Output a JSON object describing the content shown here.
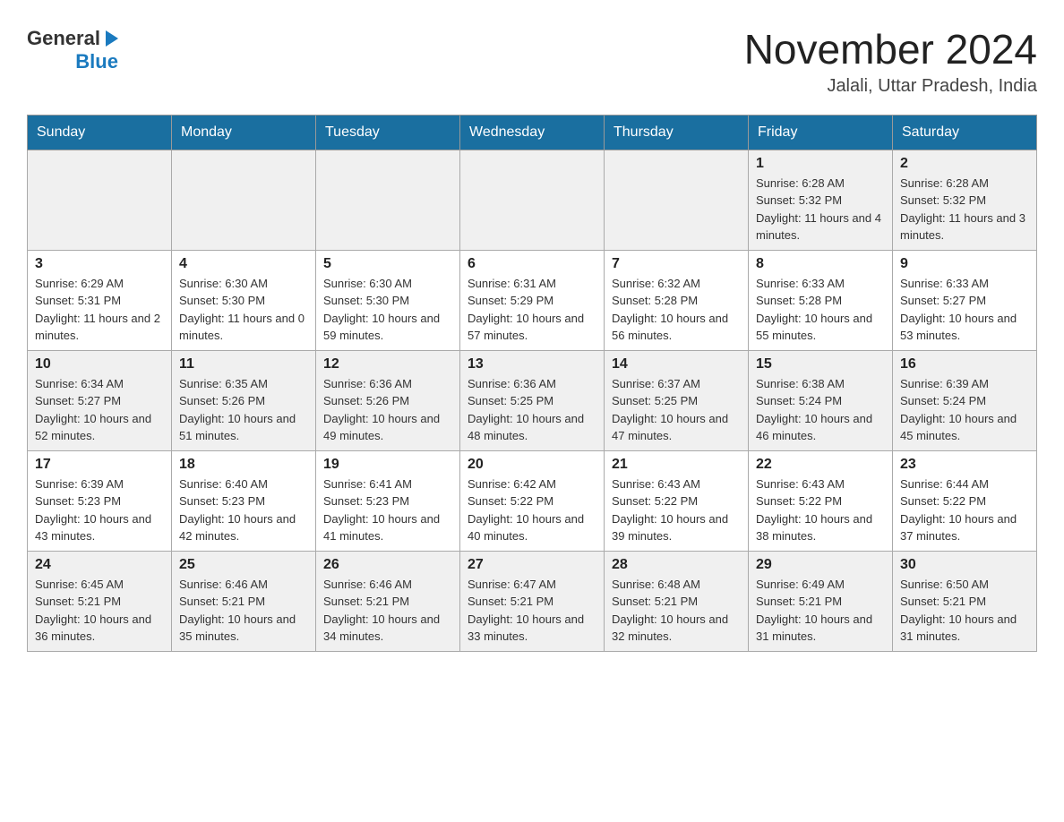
{
  "header": {
    "logo": {
      "general": "General",
      "blue": "Blue",
      "arrow": "▶"
    },
    "title": "November 2024",
    "location": "Jalali, Uttar Pradesh, India"
  },
  "calendar": {
    "days_of_week": [
      "Sunday",
      "Monday",
      "Tuesday",
      "Wednesday",
      "Thursday",
      "Friday",
      "Saturday"
    ],
    "weeks": [
      [
        {
          "day": "",
          "info": ""
        },
        {
          "day": "",
          "info": ""
        },
        {
          "day": "",
          "info": ""
        },
        {
          "day": "",
          "info": ""
        },
        {
          "day": "",
          "info": ""
        },
        {
          "day": "1",
          "info": "Sunrise: 6:28 AM\nSunset: 5:32 PM\nDaylight: 11 hours and 4 minutes."
        },
        {
          "day": "2",
          "info": "Sunrise: 6:28 AM\nSunset: 5:32 PM\nDaylight: 11 hours and 3 minutes."
        }
      ],
      [
        {
          "day": "3",
          "info": "Sunrise: 6:29 AM\nSunset: 5:31 PM\nDaylight: 11 hours and 2 minutes."
        },
        {
          "day": "4",
          "info": "Sunrise: 6:30 AM\nSunset: 5:30 PM\nDaylight: 11 hours and 0 minutes."
        },
        {
          "day": "5",
          "info": "Sunrise: 6:30 AM\nSunset: 5:30 PM\nDaylight: 10 hours and 59 minutes."
        },
        {
          "day": "6",
          "info": "Sunrise: 6:31 AM\nSunset: 5:29 PM\nDaylight: 10 hours and 57 minutes."
        },
        {
          "day": "7",
          "info": "Sunrise: 6:32 AM\nSunset: 5:28 PM\nDaylight: 10 hours and 56 minutes."
        },
        {
          "day": "8",
          "info": "Sunrise: 6:33 AM\nSunset: 5:28 PM\nDaylight: 10 hours and 55 minutes."
        },
        {
          "day": "9",
          "info": "Sunrise: 6:33 AM\nSunset: 5:27 PM\nDaylight: 10 hours and 53 minutes."
        }
      ],
      [
        {
          "day": "10",
          "info": "Sunrise: 6:34 AM\nSunset: 5:27 PM\nDaylight: 10 hours and 52 minutes."
        },
        {
          "day": "11",
          "info": "Sunrise: 6:35 AM\nSunset: 5:26 PM\nDaylight: 10 hours and 51 minutes."
        },
        {
          "day": "12",
          "info": "Sunrise: 6:36 AM\nSunset: 5:26 PM\nDaylight: 10 hours and 49 minutes."
        },
        {
          "day": "13",
          "info": "Sunrise: 6:36 AM\nSunset: 5:25 PM\nDaylight: 10 hours and 48 minutes."
        },
        {
          "day": "14",
          "info": "Sunrise: 6:37 AM\nSunset: 5:25 PM\nDaylight: 10 hours and 47 minutes."
        },
        {
          "day": "15",
          "info": "Sunrise: 6:38 AM\nSunset: 5:24 PM\nDaylight: 10 hours and 46 minutes."
        },
        {
          "day": "16",
          "info": "Sunrise: 6:39 AM\nSunset: 5:24 PM\nDaylight: 10 hours and 45 minutes."
        }
      ],
      [
        {
          "day": "17",
          "info": "Sunrise: 6:39 AM\nSunset: 5:23 PM\nDaylight: 10 hours and 43 minutes."
        },
        {
          "day": "18",
          "info": "Sunrise: 6:40 AM\nSunset: 5:23 PM\nDaylight: 10 hours and 42 minutes."
        },
        {
          "day": "19",
          "info": "Sunrise: 6:41 AM\nSunset: 5:23 PM\nDaylight: 10 hours and 41 minutes."
        },
        {
          "day": "20",
          "info": "Sunrise: 6:42 AM\nSunset: 5:22 PM\nDaylight: 10 hours and 40 minutes."
        },
        {
          "day": "21",
          "info": "Sunrise: 6:43 AM\nSunset: 5:22 PM\nDaylight: 10 hours and 39 minutes."
        },
        {
          "day": "22",
          "info": "Sunrise: 6:43 AM\nSunset: 5:22 PM\nDaylight: 10 hours and 38 minutes."
        },
        {
          "day": "23",
          "info": "Sunrise: 6:44 AM\nSunset: 5:22 PM\nDaylight: 10 hours and 37 minutes."
        }
      ],
      [
        {
          "day": "24",
          "info": "Sunrise: 6:45 AM\nSunset: 5:21 PM\nDaylight: 10 hours and 36 minutes."
        },
        {
          "day": "25",
          "info": "Sunrise: 6:46 AM\nSunset: 5:21 PM\nDaylight: 10 hours and 35 minutes."
        },
        {
          "day": "26",
          "info": "Sunrise: 6:46 AM\nSunset: 5:21 PM\nDaylight: 10 hours and 34 minutes."
        },
        {
          "day": "27",
          "info": "Sunrise: 6:47 AM\nSunset: 5:21 PM\nDaylight: 10 hours and 33 minutes."
        },
        {
          "day": "28",
          "info": "Sunrise: 6:48 AM\nSunset: 5:21 PM\nDaylight: 10 hours and 32 minutes."
        },
        {
          "day": "29",
          "info": "Sunrise: 6:49 AM\nSunset: 5:21 PM\nDaylight: 10 hours and 31 minutes."
        },
        {
          "day": "30",
          "info": "Sunrise: 6:50 AM\nSunset: 5:21 PM\nDaylight: 10 hours and 31 minutes."
        }
      ]
    ]
  }
}
